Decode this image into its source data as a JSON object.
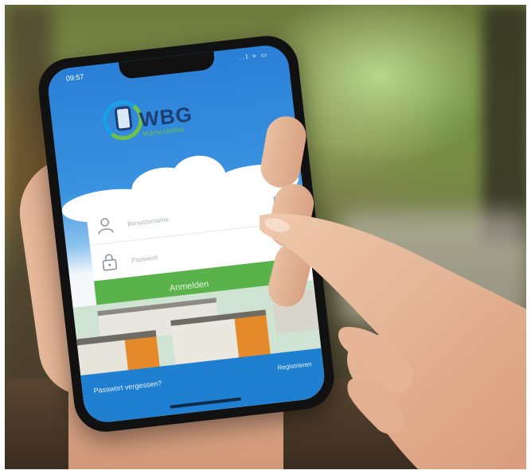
{
  "status_bar": {
    "time": "09:57",
    "icons": "..l ≈ ▭"
  },
  "logo": {
    "name": "WBG",
    "subtitle": "Marienhöhe"
  },
  "login_form": {
    "username_placeholder": "Benutzername",
    "password_placeholder": "Passwort",
    "submit_label": "Anmelden"
  },
  "footer": {
    "forgot_password": "Passwort vergessen?",
    "register": "Registrieren"
  },
  "colors": {
    "primary_blue": "#1f7fd0",
    "button_green": "#5ab24a",
    "logo_navy": "#1d3f76"
  },
  "icons": {
    "user": "user-icon",
    "lock": "lock-icon",
    "logo": "logo-icon"
  }
}
